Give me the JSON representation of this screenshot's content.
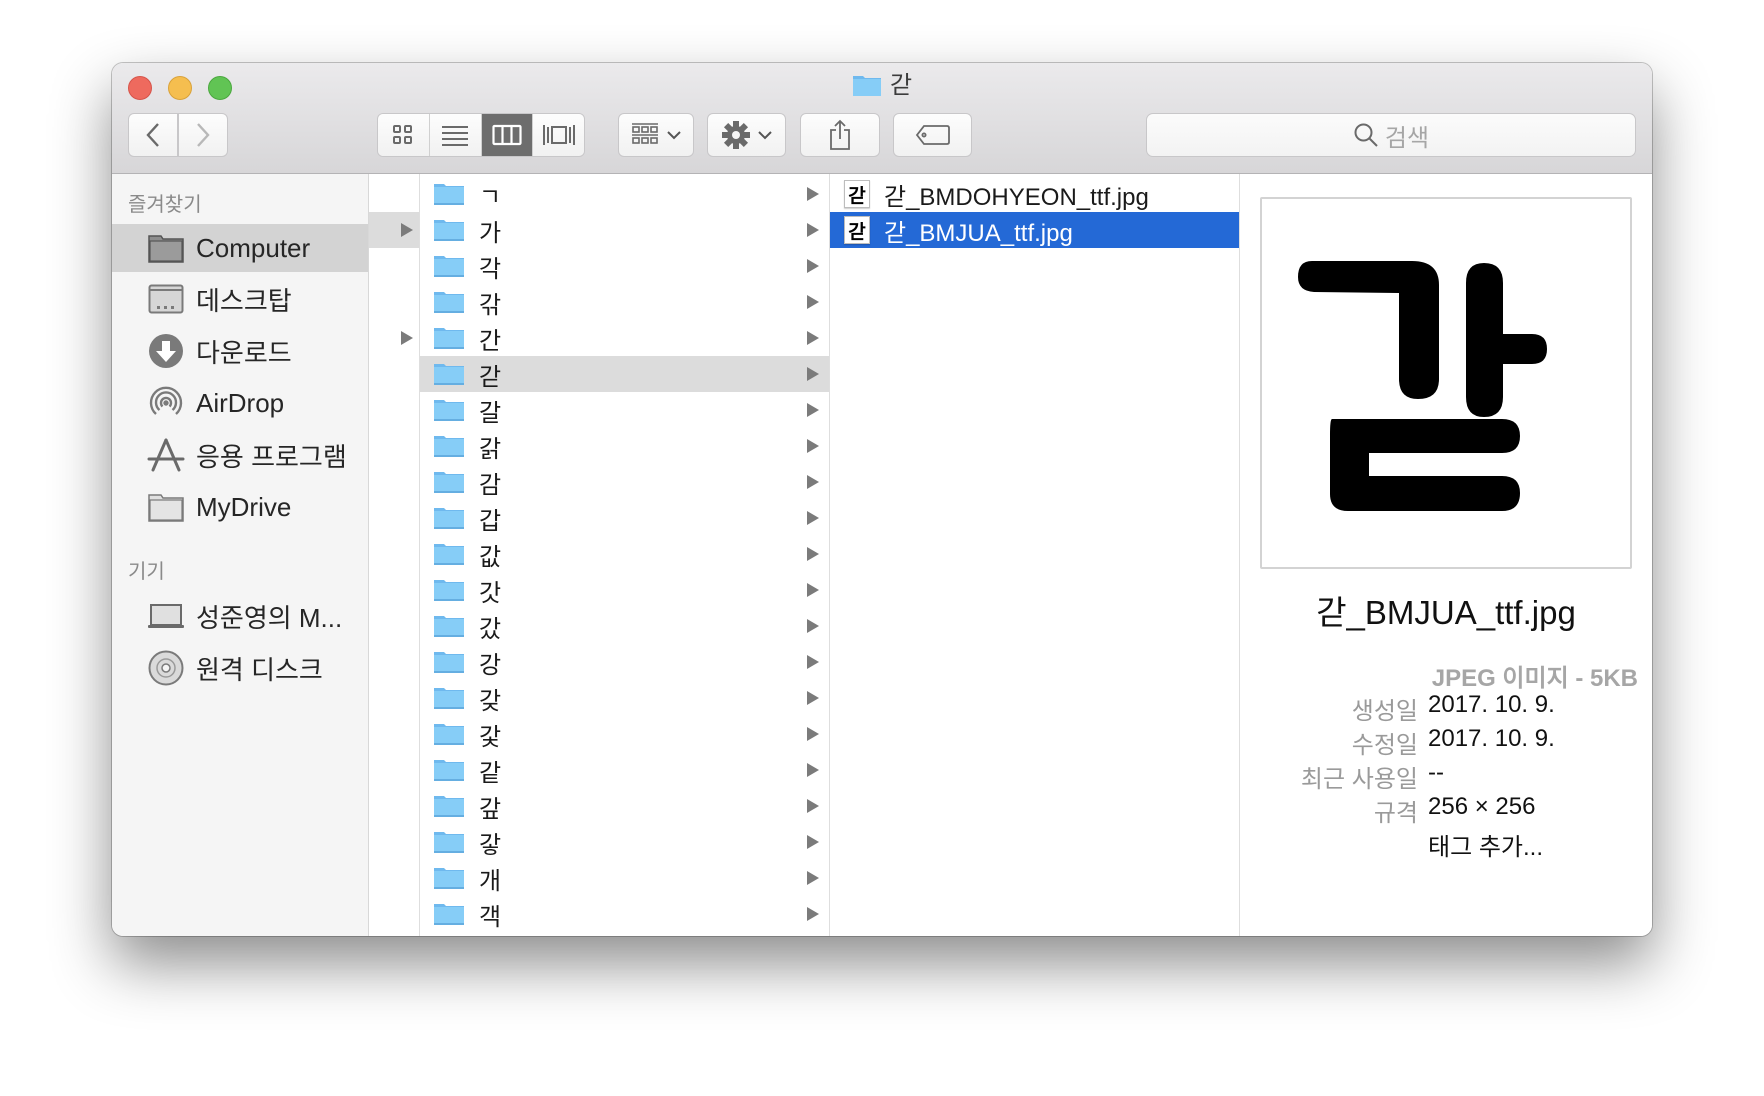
{
  "window": {
    "title": "갇",
    "title_icon": "folder-icon"
  },
  "toolbar": {
    "back_icon": "chevron-left-icon",
    "forward_icon": "chevron-right-icon",
    "view_modes": [
      {
        "name": "icon-view",
        "icon": "grid-icon",
        "active": false
      },
      {
        "name": "list-view",
        "icon": "list-icon",
        "active": false
      },
      {
        "name": "column-view",
        "icon": "columns-icon",
        "active": true
      },
      {
        "name": "cover-flow-view",
        "icon": "cover-flow-icon",
        "active": false
      }
    ],
    "arrange_icon": "arrange-grid-icon",
    "action_icon": "gear-icon",
    "share_icon": "share-icon",
    "tag_icon": "tag-icon",
    "search_placeholder": "검색"
  },
  "sidebar": {
    "favorites_header": "즐겨찾기",
    "favorites": [
      {
        "label": "Computer",
        "icon": "folder-icon",
        "selected": true
      },
      {
        "label": "데스크탑",
        "icon": "desktop-icon",
        "selected": false
      },
      {
        "label": "다운로드",
        "icon": "download-icon",
        "selected": false
      },
      {
        "label": "AirDrop",
        "icon": "airdrop-icon",
        "selected": false
      },
      {
        "label": "응용 프로그램",
        "icon": "applications-icon",
        "selected": false
      },
      {
        "label": "MyDrive",
        "icon": "folder-icon",
        "selected": false
      }
    ],
    "devices_header": "기기",
    "devices": [
      {
        "label": "성준영의 M...",
        "icon": "laptop-icon"
      },
      {
        "label": "원격 디스크",
        "icon": "disc-icon"
      }
    ]
  },
  "columns": {
    "col1": {
      "arrows_rows": [
        1,
        4
      ],
      "highlight_row": 1
    },
    "col2": {
      "items": [
        "ㄱ",
        "가",
        "각",
        "갂",
        "간",
        "갇",
        "갈",
        "갉",
        "감",
        "갑",
        "값",
        "갓",
        "갔",
        "강",
        "갖",
        "갗",
        "같",
        "갚",
        "갛",
        "개",
        "객"
      ],
      "highlight_index": 5
    },
    "col3": {
      "items": [
        {
          "name": "갇_BMDOHYEON_ttf.jpg",
          "thumb": "갇",
          "selected": false
        },
        {
          "name": "갇_BMJUA_ttf.jpg",
          "thumb": "갇",
          "selected": true
        }
      ]
    }
  },
  "preview": {
    "glyph": "갇",
    "filename": "갇_BMJUA_ttf.jpg",
    "kind": "JPEG 이미지 - 5KB",
    "fields": [
      {
        "key": "생성일",
        "value": "2017. 10. 9."
      },
      {
        "key": "수정일",
        "value": "2017. 10. 9."
      },
      {
        "key": "최근 사용일",
        "value": "--"
      },
      {
        "key": "규격",
        "value": "256 × 256"
      }
    ],
    "add_tags": "태그 추가..."
  },
  "colors": {
    "selection": "#2469d6",
    "folder_blue": "#7cc4f4",
    "link_blue": "#3b87e6"
  }
}
